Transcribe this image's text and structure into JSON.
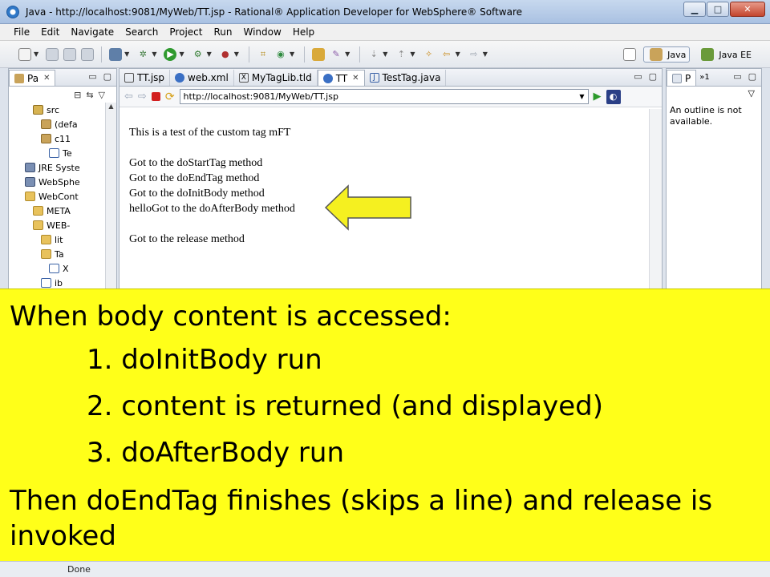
{
  "window": {
    "title": "Java - http://localhost:9081/MyWeb/TT.jsp - Rational® Application Developer for WebSphere® Software",
    "minimize": "▁",
    "maximize": "□",
    "close": "✕"
  },
  "menu": [
    "File",
    "Edit",
    "Navigate",
    "Search",
    "Project",
    "Run",
    "Window",
    "Help"
  ],
  "perspectives": [
    {
      "label": "Java",
      "active": true
    },
    {
      "label": "Java EE",
      "active": false
    }
  ],
  "left_panel": {
    "tab": "Pa",
    "tree": [
      {
        "label": "src",
        "indent": 3,
        "icon": "src"
      },
      {
        "label": "(defa",
        "indent": 4,
        "icon": "pkg"
      },
      {
        "label": "c11",
        "indent": 4,
        "icon": "pkg"
      },
      {
        "label": "Te",
        "indent": 5,
        "icon": "java"
      },
      {
        "label": "JRE Syste",
        "indent": 2,
        "icon": "lib"
      },
      {
        "label": "WebSphe",
        "indent": 2,
        "icon": "lib"
      },
      {
        "label": "WebCont",
        "indent": 2,
        "icon": "folder"
      },
      {
        "label": "META",
        "indent": 3,
        "icon": "folder"
      },
      {
        "label": "WEB-",
        "indent": 3,
        "icon": "folder"
      },
      {
        "label": "lit",
        "indent": 4,
        "icon": "folder"
      },
      {
        "label": "Ta",
        "indent": 4,
        "icon": "folder"
      },
      {
        "label": "X",
        "indent": 5,
        "icon": "java"
      },
      {
        "label": "ib",
        "indent": 4,
        "icon": "java"
      }
    ]
  },
  "editor": {
    "tabs": [
      {
        "label": "TT.jsp",
        "icon": "jsp-icon"
      },
      {
        "label": "web.xml",
        "icon": "globe-icon"
      },
      {
        "label": "MyTagLib.tld",
        "icon": "xml-icon"
      },
      {
        "label": "TT",
        "icon": "globe-icon",
        "active": true
      },
      {
        "label": "TestTag.java",
        "icon": "java-icon"
      }
    ],
    "url": "http://localhost:9081/MyWeb/TT.jsp",
    "page_lines": [
      "This is a test of the custom tag mFT",
      "",
      "Got to the doStartTag method",
      "Got to the doEndTag method",
      "Got to the doInitBody method",
      "helloGot to the doAfterBody method",
      "",
      "Got to the release method"
    ]
  },
  "right_panel": {
    "tab": "P",
    "extra": "»1",
    "message": "An outline is not available."
  },
  "overlay": {
    "heading": "When body content is accessed:",
    "items": [
      "1. doInitBody run",
      "2. content is returned (and displayed)",
      "3. doAfterBody run"
    ],
    "footer": "Then doEndTag finishes (skips a line) and release is invoked"
  },
  "status": {
    "text": "Done"
  },
  "colors": {
    "overlay": "#ffff19",
    "arrow": "#f5f020"
  }
}
